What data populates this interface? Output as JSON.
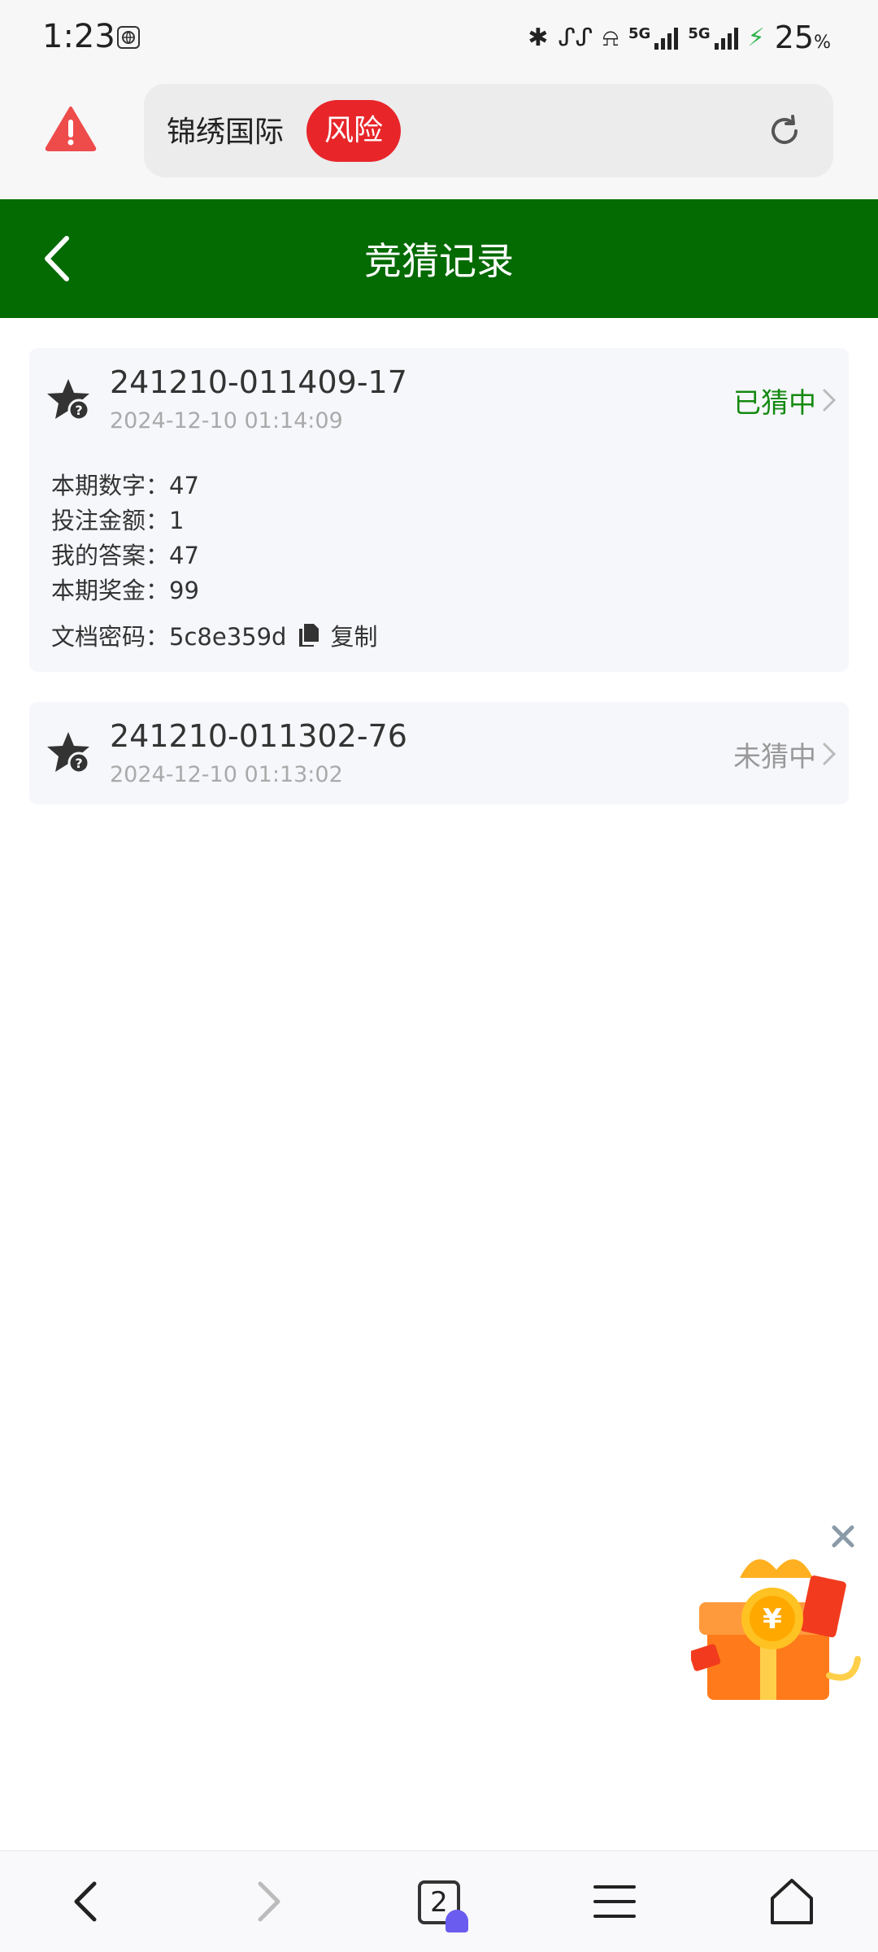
{
  "status_bar": {
    "time": "1:23",
    "network_1": "5G",
    "network_2": "5G",
    "battery": "25",
    "battery_unit": "%"
  },
  "browser": {
    "site_name": "锦绣国际",
    "risk_label": "风险",
    "open_tabs": "2"
  },
  "header": {
    "title": "竞猜记录"
  },
  "records": [
    {
      "id": "241210-011409-17",
      "time": "2024-12-10 01:14:09",
      "status": "已猜中",
      "details": [
        {
          "label": "本期数字：",
          "value": "47"
        },
        {
          "label": "投注金额：",
          "value": "1"
        },
        {
          "label": "我的答案：",
          "value": "47"
        },
        {
          "label": "本期奖金：",
          "value": "99"
        }
      ],
      "doc_label": "文档密码：",
      "doc_password": "5c8e359d",
      "copy_label": "复制"
    },
    {
      "id": "241210-011302-76",
      "time": "2024-12-10 01:13:02",
      "status": "未猜中"
    }
  ],
  "colors": {
    "header_bg": "#046a02",
    "win": "#158a11",
    "lose": "#999999",
    "risk": "#e8262a"
  }
}
